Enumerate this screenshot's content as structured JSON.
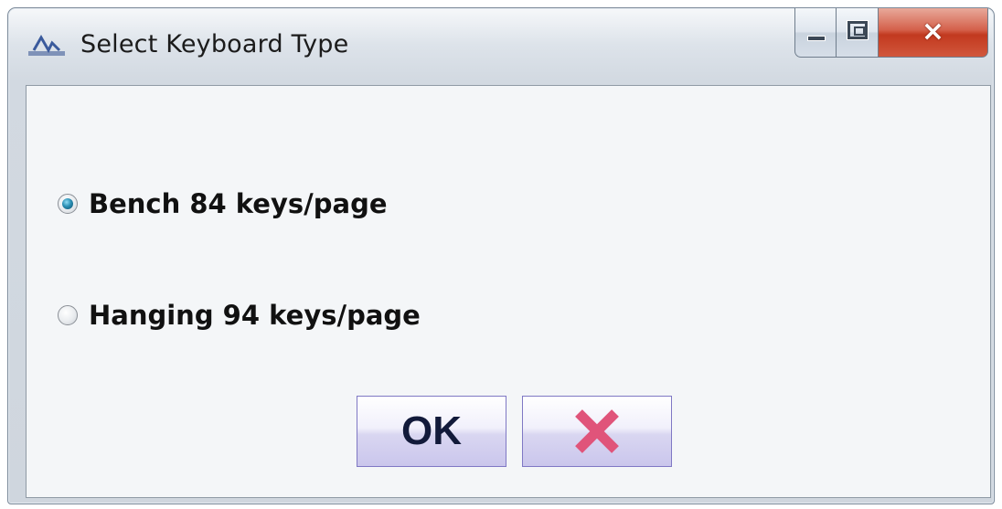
{
  "window": {
    "title": "Select Keyboard Type",
    "caption_buttons": {
      "minimize": "minimize-icon",
      "maximize": "maximize-icon",
      "close": "×"
    }
  },
  "options": [
    {
      "label": "Bench 84 keys/page",
      "selected": true
    },
    {
      "label": "Hanging 94 keys/page",
      "selected": false
    }
  ],
  "buttons": {
    "ok_label": "OK",
    "cancel_icon": "x-icon"
  },
  "colors": {
    "radio_selected": "#2a8fb4",
    "cancel_x": "#e0547a",
    "ok_text": "#121a3a",
    "close_button": "#c2391f"
  }
}
